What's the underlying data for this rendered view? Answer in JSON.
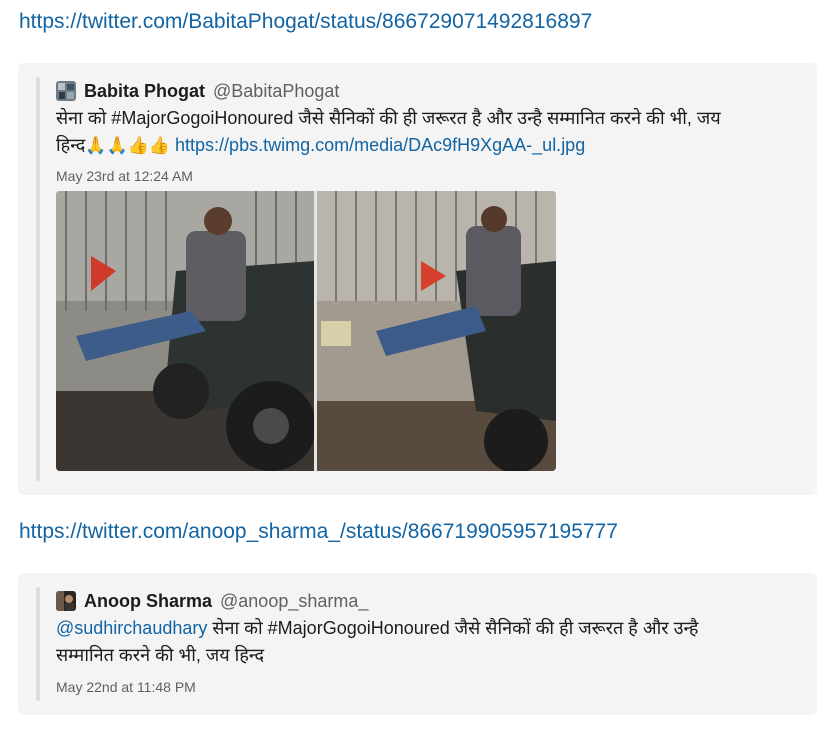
{
  "messages": [
    {
      "url": "https://twitter.com/BabitaPhogat/status/866729071492816897",
      "author": "Babita Phogat",
      "handle": "@BabitaPhogat",
      "text_line1": "सेना को #MajorGogoiHonoured  जैसे सैनिकों की ही जरूरत है और उन्है सम्मानित करने की भी,  जय",
      "text_line2_prefix": "हिन्द",
      "emojis": "🙏🙏👍👍",
      "media_link": "https://pbs.twimg.com/media/DAc9fH9XgAA-_ul.jpg",
      "timestamp": "May 23rd at 12:24 AM"
    },
    {
      "url": "https://twitter.com/anoop_sharma_/status/866719905957195777",
      "author": "Anoop Sharma",
      "handle": "@anoop_sharma_",
      "mention": "@sudhirchaudhary",
      "text_line1": " सेना को #MajorGogoiHonoured  जैसे सैनिकों की ही जरूरत है और उन्है",
      "text_line2": "सम्मानित करने की भी, जय हिन्द",
      "timestamp": "May 22nd at 11:48 PM"
    }
  ],
  "icons": {
    "avatar1": "user-avatar-icon",
    "avatar2": "user-avatar-icon"
  },
  "colors": {
    "link": "#1264a3",
    "card_bg": "#f4f4f4",
    "quote_bar": "#dddddd",
    "muted": "#616061"
  }
}
